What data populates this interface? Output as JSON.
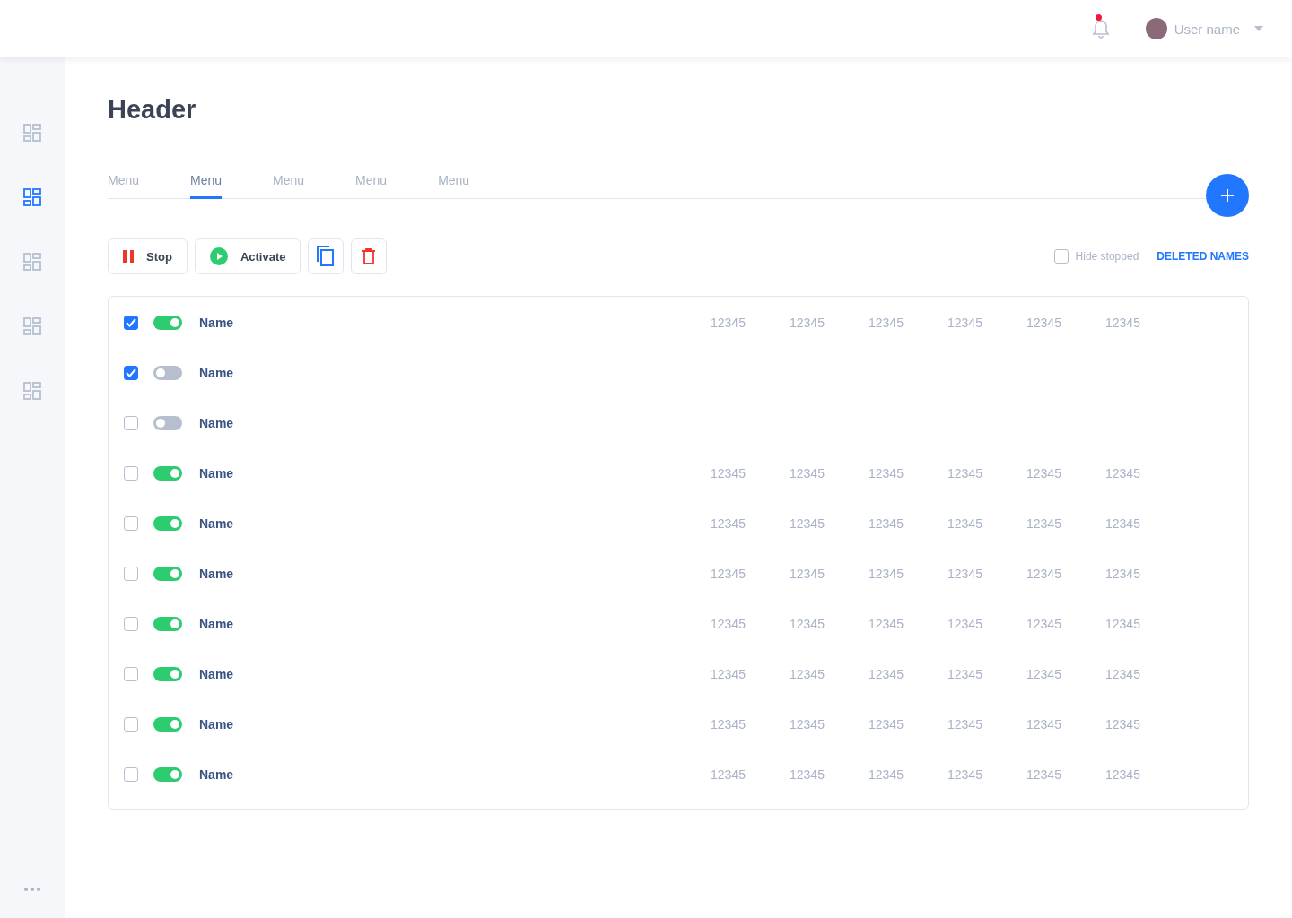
{
  "topbar": {
    "notification": {
      "unread": true
    },
    "user": {
      "name": "User name"
    }
  },
  "sidebar": {
    "items": [
      {
        "selected": false
      },
      {
        "selected": true
      },
      {
        "selected": false
      },
      {
        "selected": false
      },
      {
        "selected": false
      }
    ]
  },
  "page": {
    "title": "Header"
  },
  "tabs": [
    {
      "label": "Menu",
      "selected": false
    },
    {
      "label": "Menu",
      "selected": true
    },
    {
      "label": "Menu",
      "selected": false
    },
    {
      "label": "Menu",
      "selected": false
    },
    {
      "label": "Menu",
      "selected": false
    }
  ],
  "toolbar": {
    "stop": "Stop",
    "activate": "Activate",
    "hide_stopped": {
      "label": "Hide stopped",
      "checked": false
    },
    "deleted_link": "DELETED NAMES"
  },
  "rows": [
    {
      "checked": true,
      "on": true,
      "name": "Name",
      "values": [
        "12345",
        "12345",
        "12345",
        "12345",
        "12345",
        "12345"
      ]
    },
    {
      "checked": true,
      "on": false,
      "name": "Name",
      "values": []
    },
    {
      "checked": false,
      "on": false,
      "name": "Name",
      "values": []
    },
    {
      "checked": false,
      "on": true,
      "name": "Name",
      "values": [
        "12345",
        "12345",
        "12345",
        "12345",
        "12345",
        "12345"
      ]
    },
    {
      "checked": false,
      "on": true,
      "name": "Name",
      "values": [
        "12345",
        "12345",
        "12345",
        "12345",
        "12345",
        "12345"
      ]
    },
    {
      "checked": false,
      "on": true,
      "name": "Name",
      "values": [
        "12345",
        "12345",
        "12345",
        "12345",
        "12345",
        "12345"
      ]
    },
    {
      "checked": false,
      "on": true,
      "name": "Name",
      "values": [
        "12345",
        "12345",
        "12345",
        "12345",
        "12345",
        "12345"
      ]
    },
    {
      "checked": false,
      "on": true,
      "name": "Name",
      "values": [
        "12345",
        "12345",
        "12345",
        "12345",
        "12345",
        "12345"
      ]
    },
    {
      "checked": false,
      "on": true,
      "name": "Name",
      "values": [
        "12345",
        "12345",
        "12345",
        "12345",
        "12345",
        "12345"
      ]
    },
    {
      "checked": false,
      "on": true,
      "name": "Name",
      "values": [
        "12345",
        "12345",
        "12345",
        "12345",
        "12345",
        "12345"
      ]
    }
  ]
}
